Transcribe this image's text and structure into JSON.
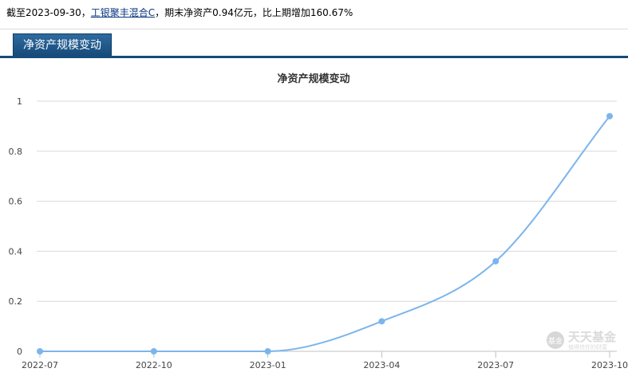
{
  "summary": {
    "prefix": "截至2023-09-30，",
    "fund_link": "工银聚丰混合C",
    "suffix": "，期末净资产0.94亿元，比上期增加160.67%"
  },
  "tab": {
    "label": "净资产规模变动"
  },
  "watermark": {
    "badge": "基金",
    "name": "天天基金",
    "slogan": "值得信任的财富"
  },
  "chart_data": {
    "type": "line",
    "title": "净资产规模变动",
    "xlabel": "",
    "ylabel": "",
    "categories": [
      "2022-07",
      "2022-10",
      "2023-01",
      "2023-04",
      "2023-07",
      "2023-10"
    ],
    "series": [
      {
        "x": [
          "2022-06-30",
          "2022-09-30",
          "2022-12-31",
          "2023-03-31",
          "2023-06-30",
          "2023-09-30"
        ],
        "values": [
          0,
          0,
          0,
          0.12,
          0.36,
          0.94
        ]
      }
    ],
    "ylim": [
      0,
      1
    ],
    "yticks": [
      "0",
      "0.2",
      "0.4",
      "0.6",
      "0.8",
      "1"
    ],
    "grid": true,
    "legend": "none",
    "line_color": "#7cb5ec",
    "grid_color": "#d8d8d8"
  }
}
